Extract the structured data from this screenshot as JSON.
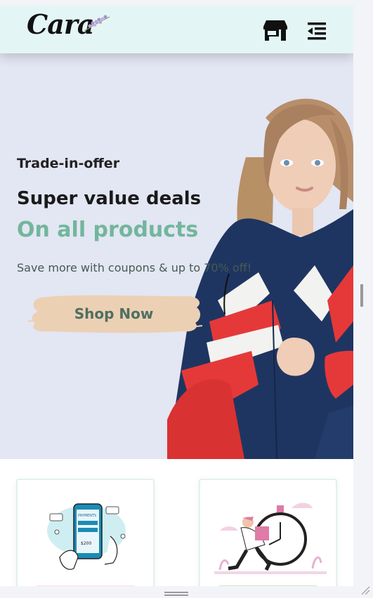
{
  "brand": {
    "logo_text": "Cara"
  },
  "header": {
    "store_icon": "store-icon",
    "menu_icon": "menu-icon"
  },
  "hero": {
    "tag": "Trade-in-offer",
    "headline": "Super value deals",
    "highlight": "On all products",
    "subtitle": "Save more with coupons & up to 70% off!",
    "cta_label": "Shop Now",
    "colors": {
      "background": "#e3e6f3",
      "accent": "#72b69c",
      "button_bg": "#ecd0b3"
    }
  },
  "features": [
    {
      "illustration": "payment-phone-illustration",
      "badge_color": "#fddde4"
    },
    {
      "illustration": "delivery-clock-illustration",
      "badge_color": "#cdebbc"
    }
  ]
}
